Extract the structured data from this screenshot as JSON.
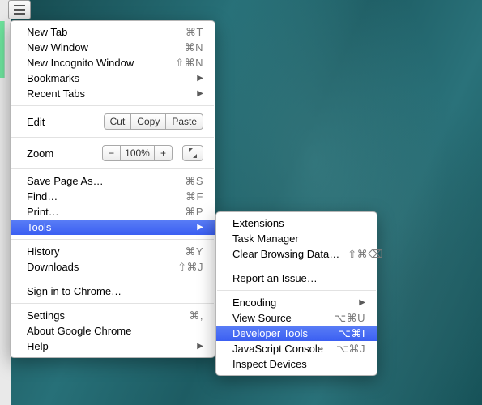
{
  "menu": {
    "new_tab": {
      "label": "New Tab",
      "shortcut": "⌘T"
    },
    "new_window": {
      "label": "New Window",
      "shortcut": "⌘N"
    },
    "new_incognito": {
      "label": "New Incognito Window",
      "shortcut": "⇧⌘N"
    },
    "bookmarks": {
      "label": "Bookmarks"
    },
    "recent_tabs": {
      "label": "Recent Tabs"
    },
    "edit": {
      "label": "Edit",
      "cut": "Cut",
      "copy": "Copy",
      "paste": "Paste"
    },
    "zoom": {
      "label": "Zoom",
      "minus": "−",
      "value": "100%",
      "plus": "+"
    },
    "save_as": {
      "label": "Save Page As…",
      "shortcut": "⌘S"
    },
    "find": {
      "label": "Find…",
      "shortcut": "⌘F"
    },
    "print": {
      "label": "Print…",
      "shortcut": "⌘P"
    },
    "tools": {
      "label": "Tools"
    },
    "history": {
      "label": "History",
      "shortcut": "⌘Y"
    },
    "downloads": {
      "label": "Downloads",
      "shortcut": "⇧⌘J"
    },
    "signin": {
      "label": "Sign in to Chrome…"
    },
    "settings": {
      "label": "Settings",
      "shortcut": "⌘,"
    },
    "about": {
      "label": "About Google Chrome"
    },
    "help": {
      "label": "Help"
    }
  },
  "submenu": {
    "extensions": {
      "label": "Extensions"
    },
    "task_manager": {
      "label": "Task Manager"
    },
    "clear_data": {
      "label": "Clear Browsing Data…",
      "shortcut": "⇧⌘⌫"
    },
    "report": {
      "label": "Report an Issue…"
    },
    "encoding": {
      "label": "Encoding"
    },
    "view_source": {
      "label": "View Source",
      "shortcut": "⌥⌘U"
    },
    "dev_tools": {
      "label": "Developer Tools",
      "shortcut": "⌥⌘I"
    },
    "js_console": {
      "label": "JavaScript Console",
      "shortcut": "⌥⌘J"
    },
    "inspect_devices": {
      "label": "Inspect Devices"
    }
  }
}
